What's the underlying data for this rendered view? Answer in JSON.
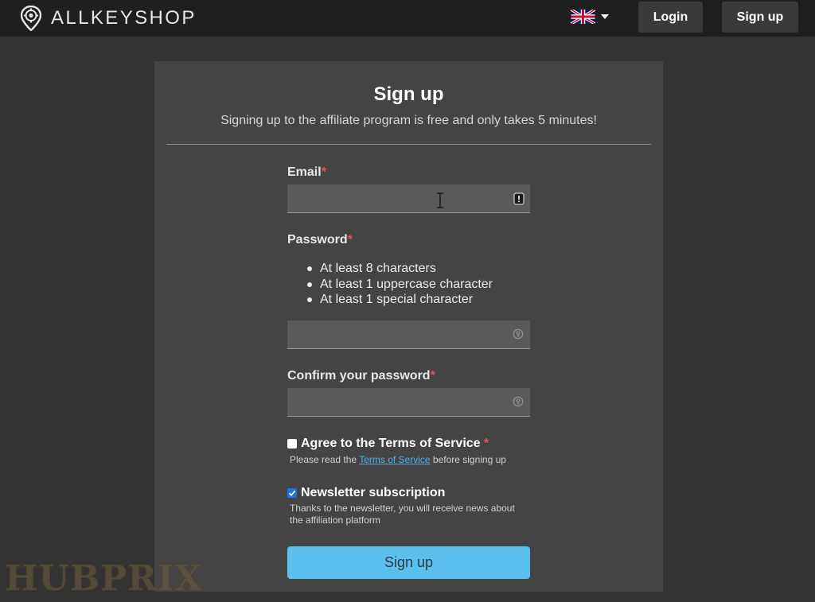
{
  "header": {
    "logo_text": "ALLKEYSHOP",
    "language_flag": "uk-flag-icon",
    "login_label": "Login",
    "signup_label": "Sign up"
  },
  "form": {
    "title": "Sign up",
    "subtitle": "Signing up to the affiliate program is free and only takes 5 minutes!",
    "required_mark": "*",
    "email": {
      "label": "Email",
      "value": ""
    },
    "password": {
      "label": "Password",
      "rules": [
        "At least 8 characters",
        "At least 1 uppercase character",
        "At least 1 special character"
      ],
      "value": ""
    },
    "confirm_password": {
      "label": "Confirm your password",
      "value": ""
    },
    "terms": {
      "label": "Agree to the Terms of Service",
      "checked": false,
      "helper_prefix": "Please read the ",
      "helper_link": "Terms of Service",
      "helper_suffix": " before signing up"
    },
    "newsletter": {
      "label": "Newsletter subscription",
      "checked": true,
      "helper": "Thanks to the newsletter, you will receive news about the affiliation platform"
    },
    "submit_label": "Sign up"
  },
  "watermark": "HUBPRIX",
  "colors": {
    "background": "#333333",
    "topbar": "#1f1f1f",
    "card": "#444444",
    "accent_button": "#5bc0ee",
    "link": "#4fb3e8",
    "required": "#e25555"
  }
}
